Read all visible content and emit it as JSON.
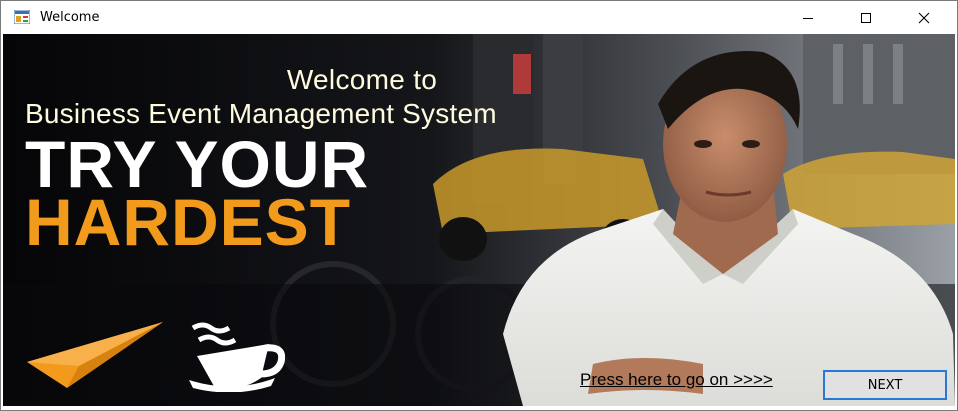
{
  "window": {
    "title": "Welcome"
  },
  "hero": {
    "welcome_line1": "Welcome to",
    "welcome_line2": "Business Event Management System",
    "slogan_line1": "TRY YOUR",
    "slogan_line2": "HARDEST"
  },
  "actions": {
    "press_link_label": "Press here to go on >>>>",
    "next_button_label": "NEXT"
  },
  "colors": {
    "slogan_white": "#ffffff",
    "slogan_orange": "#f29a1c",
    "welcome_text": "#fffbe0",
    "button_border": "#2a78d6"
  },
  "icons": {
    "app": "app-icon",
    "minimize": "minimize-icon",
    "maximize": "maximize-icon",
    "close": "close-icon",
    "plane": "paper-plane-icon",
    "coffee": "coffee-cup-icon"
  }
}
